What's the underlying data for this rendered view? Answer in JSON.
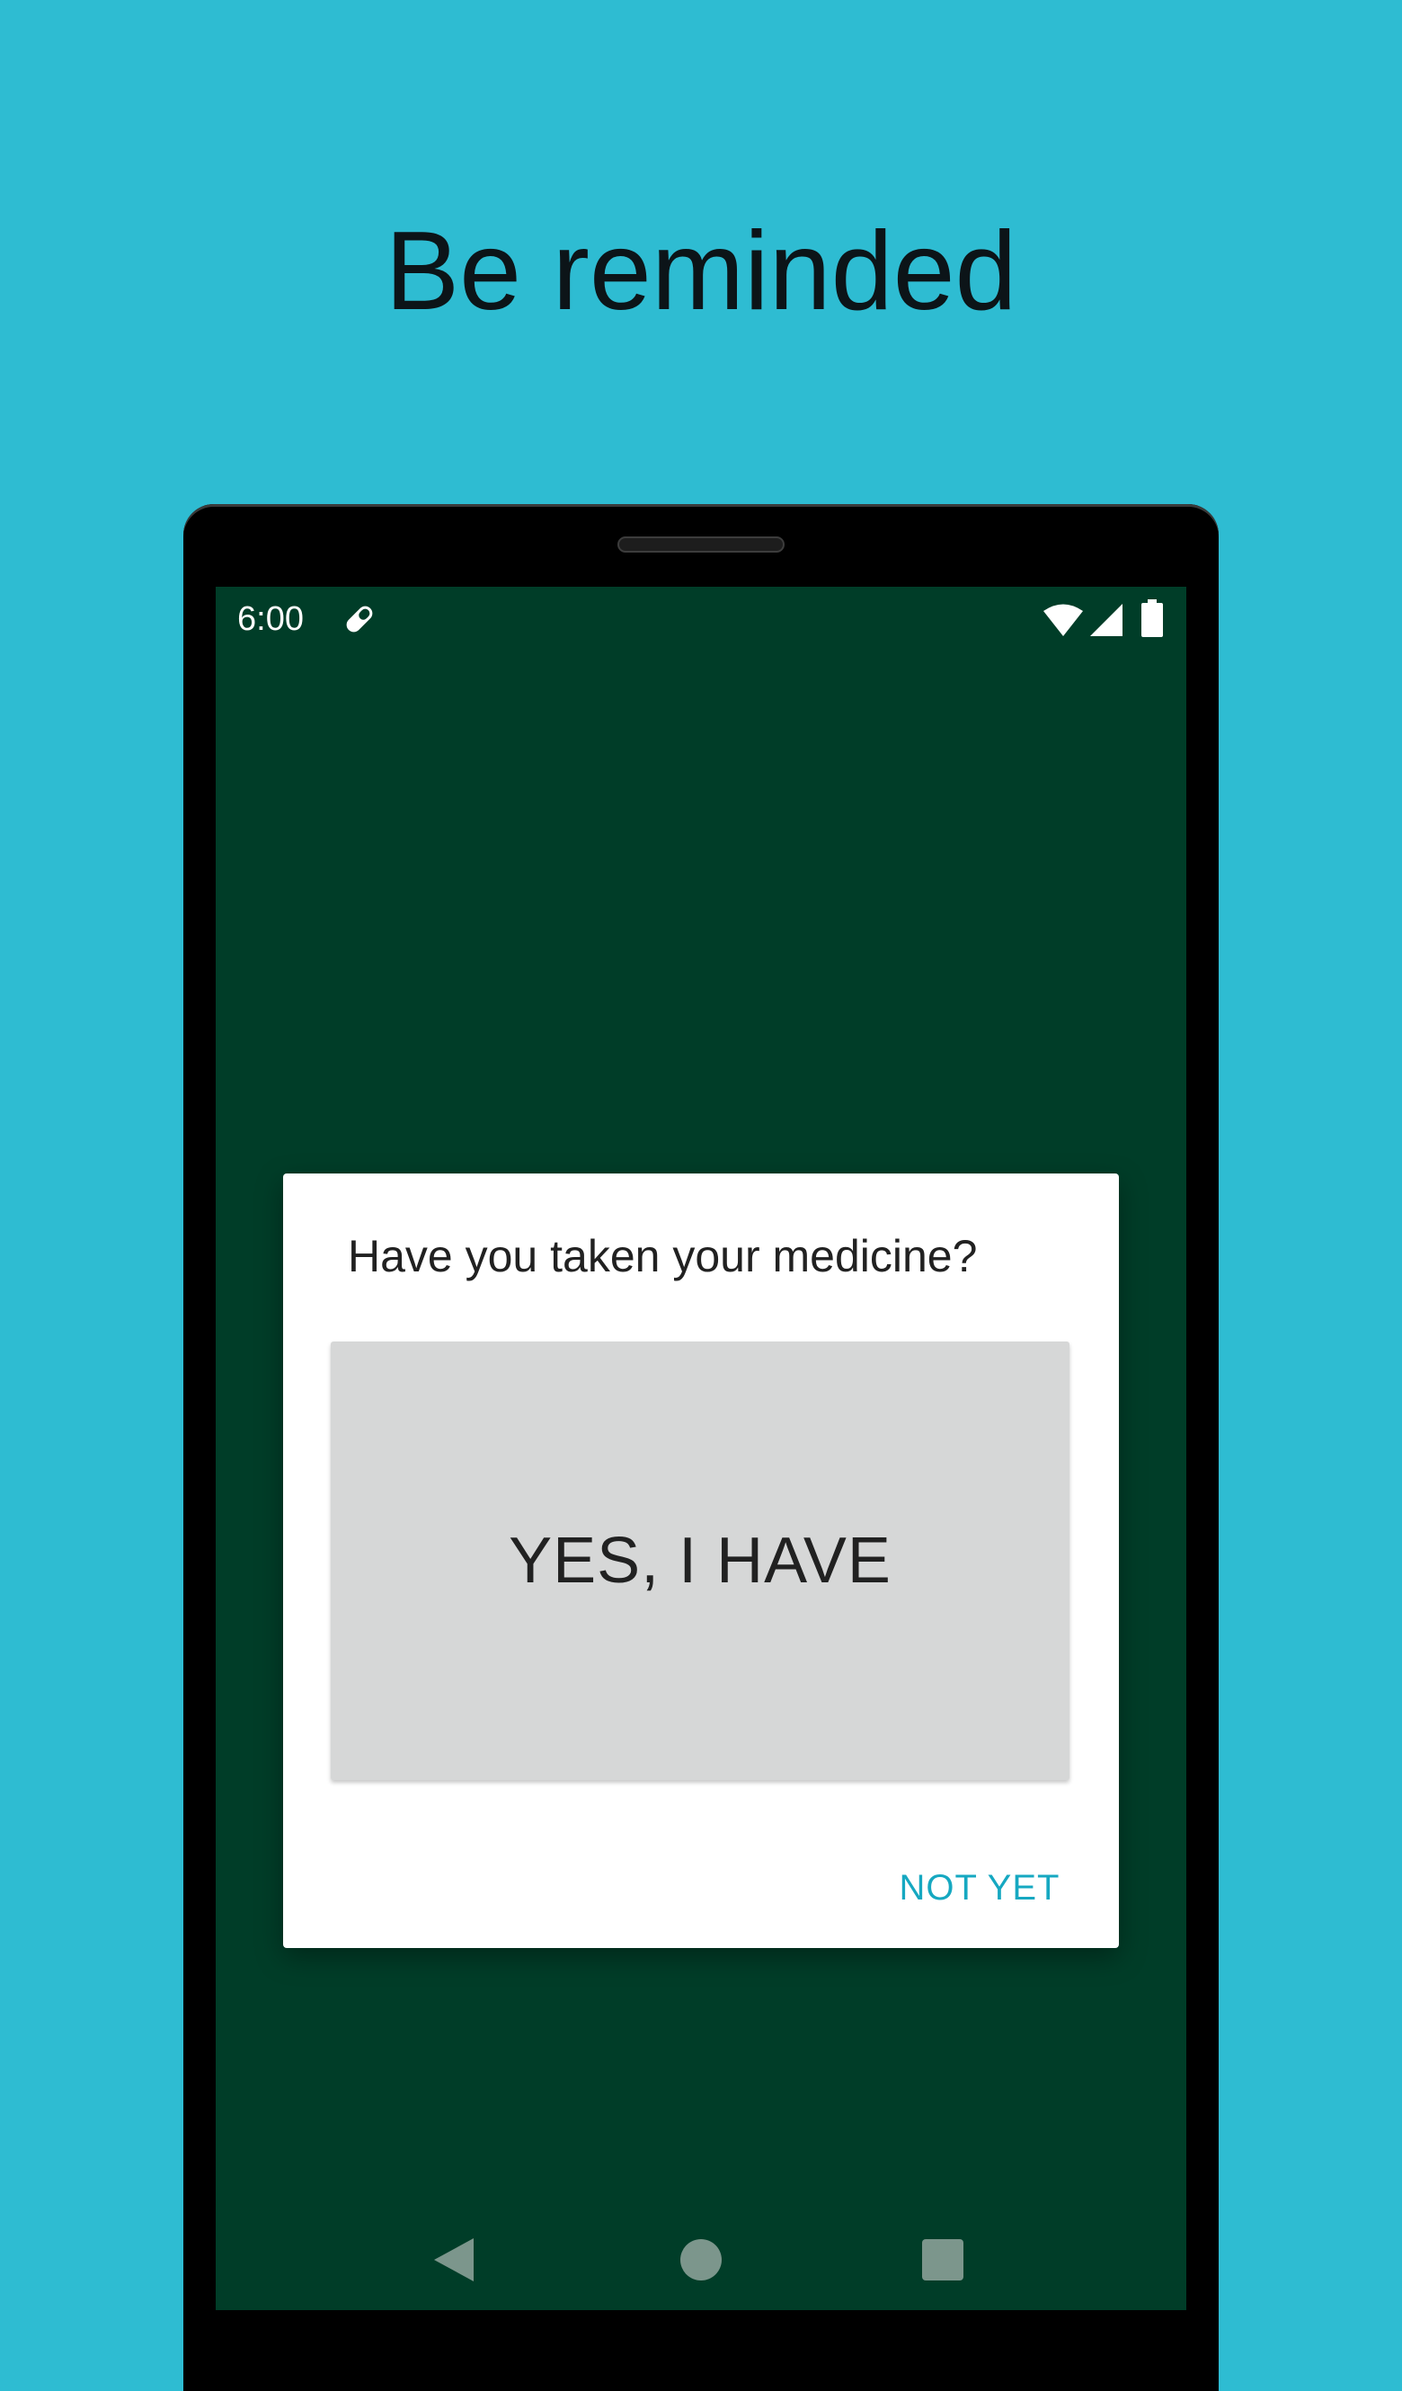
{
  "headline": "Be reminded",
  "status_bar": {
    "time": "6:00",
    "notification_icon": "pill-icon",
    "wifi_icon": "wifi-icon",
    "signal_icon": "cell-signal-icon",
    "battery_icon": "battery-icon"
  },
  "dialog": {
    "title": "Have you taken your medicine?",
    "confirm_label": "YES, I HAVE",
    "dismiss_label": "NOT YET"
  },
  "nav_bar": {
    "back_icon": "back-icon",
    "home_icon": "home-icon",
    "recents_icon": "recents-icon"
  },
  "colors": {
    "page_background": "#2ebcd2",
    "screen_background": "#003d28",
    "dialog_background": "#ffffff",
    "confirm_button": "#d6d7d7",
    "accent": "#16a8c1",
    "nav_icons": "#7c968c"
  }
}
